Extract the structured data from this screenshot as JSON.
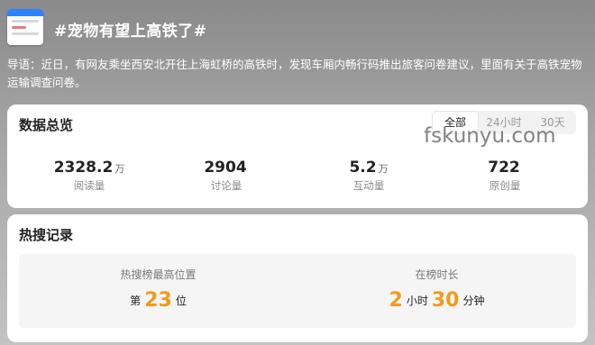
{
  "title": "#宠物有望上高铁了#",
  "intro": "导语：近日，有网友乘坐西安北开往上海虹桥的高铁时，发现车厢内畅行码推出旅客问卷建议，里面有关于高铁宠物运输调查问卷。",
  "watermark": "fskunyu.com",
  "overview": {
    "title": "数据总览",
    "tabs": [
      "全部",
      "24小时",
      "30天"
    ],
    "active_tab": "全部",
    "stats": [
      {
        "value": "2328.2",
        "unit": "万",
        "label": "阅读量"
      },
      {
        "value": "2904",
        "unit": "",
        "label": "讨论量"
      },
      {
        "value": "5.2",
        "unit": "万",
        "label": "互动量"
      },
      {
        "value": "722",
        "unit": "",
        "label": "原创量"
      }
    ]
  },
  "hot": {
    "title": "热搜记录",
    "rank_label": "热搜榜最高位置",
    "rank_prefix": "第",
    "rank_value": "23",
    "rank_suffix": "位",
    "duration_label": "在榜时长",
    "hours": "2",
    "hours_unit": "小时",
    "minutes": "30",
    "minutes_unit": "分钟"
  },
  "colors": {
    "accent": "#f39a1e",
    "thumb_bar": "#2e82ff"
  }
}
